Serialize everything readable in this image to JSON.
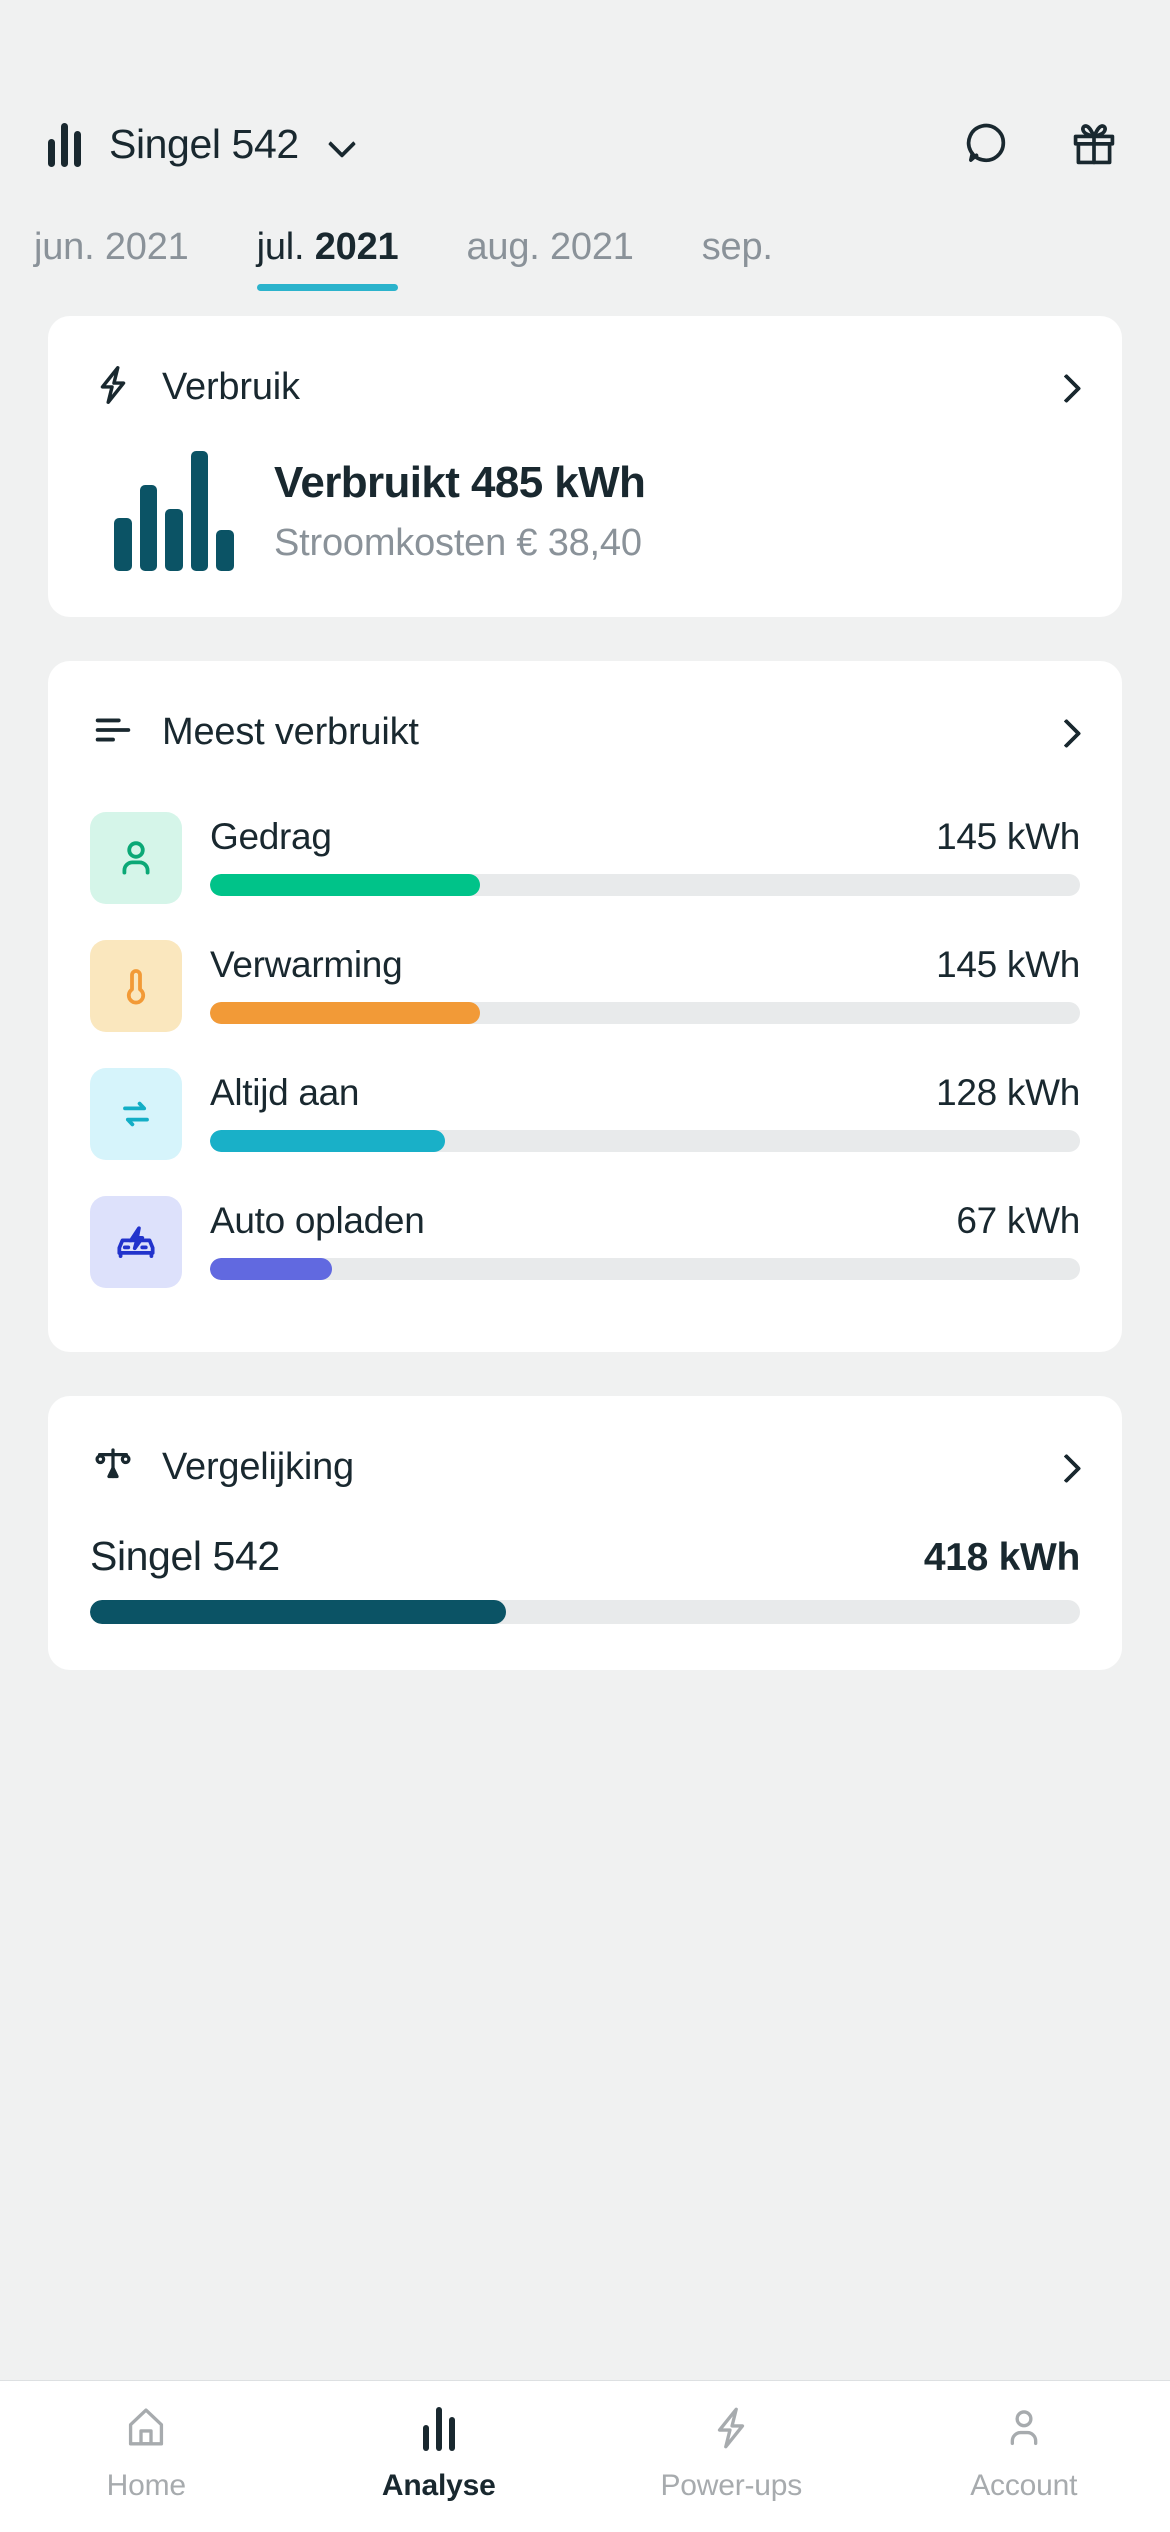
{
  "header": {
    "title": "Singel 542",
    "brand_icon": "bar-chart-icon",
    "dropdown_icon": "chevron-down-icon",
    "chat_icon": "chat-bubble-icon",
    "gift_icon": "gift-icon"
  },
  "month_tabs": [
    {
      "label": "jun.",
      "year": "2021",
      "active": false
    },
    {
      "label": "jul.",
      "year": "2021",
      "active": true
    },
    {
      "label": "aug.",
      "year": "2021",
      "active": false
    },
    {
      "label": "sep.",
      "year": "",
      "active": false
    }
  ],
  "verbruik_card": {
    "icon": "lightning-bolt-icon",
    "title": "Verbruik",
    "chevron": "chevron-right-icon",
    "main_text": "Verbruikt 485 kWh",
    "sub_text": "Stroomkosten € 38,40"
  },
  "meest_verbruikt_card": {
    "icon": "sort-lines-icon",
    "title": "Meest verbruikt",
    "chevron": "chevron-right-icon",
    "rows": [
      {
        "label": "Gedrag",
        "value": "145 kWh",
        "icon": "person-icon",
        "icon_bg": "#D5F5E9",
        "icon_color": "#0BA876",
        "bar_color": "#00C389",
        "pct": 31
      },
      {
        "label": "Verwarming",
        "value": "145 kWh",
        "icon": "thermometer-icon",
        "icon_bg": "#FAE7BE",
        "icon_color": "#F29A37",
        "bar_color": "#F29A37",
        "pct": 31
      },
      {
        "label": "Altijd aan",
        "value": "128 kWh",
        "icon": "repeat-icon",
        "icon_bg": "#D6F4FB",
        "icon_color": "#13AEC6",
        "bar_color": "#19B0C8",
        "pct": 27
      },
      {
        "label": "Auto opladen",
        "value": "67 kWh",
        "icon": "ev-car-icon",
        "icon_bg": "#DDE1FB",
        "icon_color": "#2233CC",
        "bar_color": "#6169E0",
        "pct": 14
      }
    ]
  },
  "vergelijking_card": {
    "icon": "scales-icon",
    "title": "Vergelijking",
    "chevron": "chevron-right-icon",
    "row": {
      "label": "Singel 542",
      "value": "418 kWh",
      "bar_color": "#0B5365",
      "pct": 42
    }
  },
  "bottom_nav": [
    {
      "label": "Home",
      "icon": "home-icon",
      "active": false
    },
    {
      "label": "Analyse",
      "icon": "bar-chart-icon",
      "active": true
    },
    {
      "label": "Power-ups",
      "icon": "lightning-bolt-icon",
      "active": false
    },
    {
      "label": "Account",
      "icon": "person-icon",
      "active": false
    }
  ],
  "chart_data": {
    "type": "bar",
    "title": "Meest verbruikt",
    "xlabel": "",
    "ylabel": "kWh",
    "categories": [
      "Gedrag",
      "Verwarming",
      "Altijd aan",
      "Auto opladen"
    ],
    "values": [
      145,
      145,
      128,
      67
    ],
    "unit": "kWh",
    "total": 485,
    "ylim": [
      0,
      470
    ],
    "grid": false,
    "legend": "none",
    "comparison": {
      "categories": [
        "Singel 542"
      ],
      "values": [
        418
      ],
      "unit": "kWh"
    },
    "sparkline": {
      "type": "bar",
      "values": [
        44,
        72,
        52,
        100,
        34
      ],
      "color": "#0B5365"
    }
  }
}
